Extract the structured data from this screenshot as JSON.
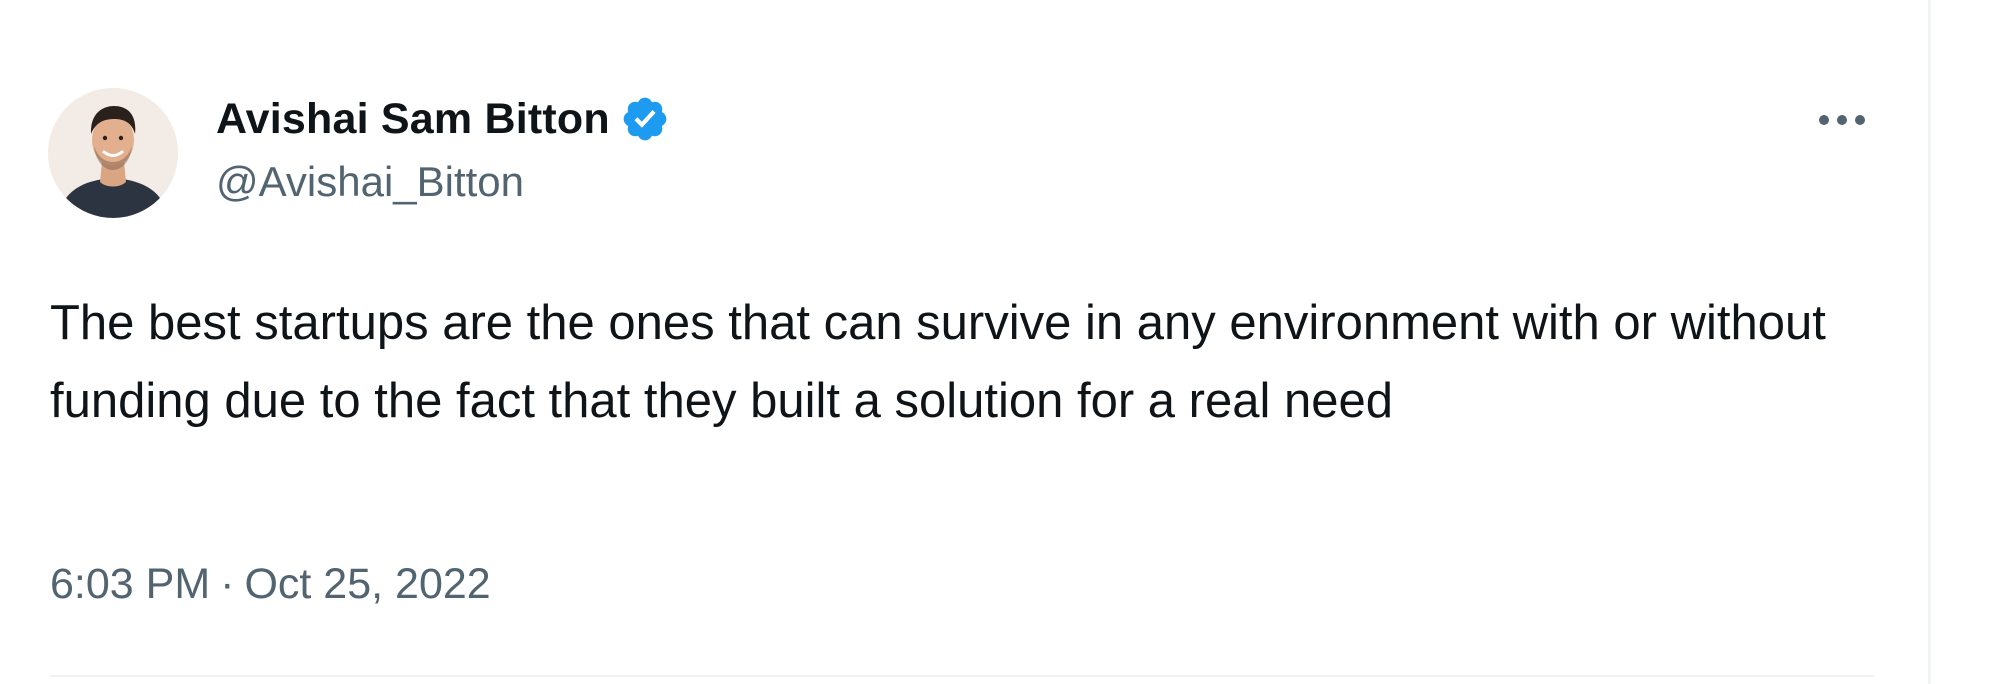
{
  "author": {
    "display_name": "Avishai Sam Bitton",
    "handle": "@Avishai_Bitton",
    "verified": true
  },
  "tweet": {
    "text": "The best startups are the ones that can survive in any environment with or without funding due to the fact that they built a solution for a real need",
    "time": "6:03 PM",
    "separator": "·",
    "date": "Oct 25, 2022"
  },
  "icons": {
    "verified": "verified-badge-icon",
    "more": "more-options-icon"
  },
  "colors": {
    "verified_blue": "#1d9bf0",
    "text_primary": "#0f1419",
    "text_secondary": "#536471",
    "divider": "#eff3f4"
  }
}
